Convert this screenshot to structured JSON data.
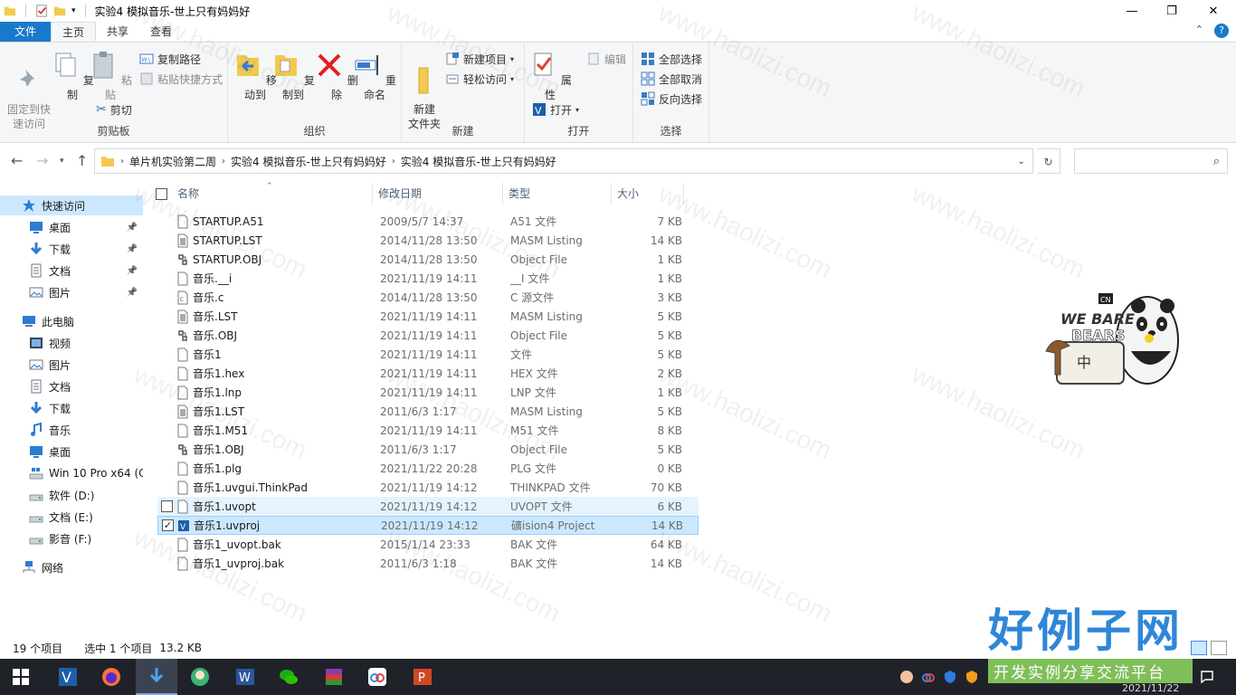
{
  "window": {
    "title": "实验4 模拟音乐-世上只有妈妈好",
    "minimize": "—",
    "maximize": "❐",
    "close": "✕"
  },
  "tabs": [
    "文件",
    "主页",
    "共享",
    "查看"
  ],
  "ribbon": {
    "clipboard": {
      "label": "剪贴板",
      "pin": "固定到快\n速访问",
      "copy": "复制",
      "paste": "粘贴",
      "copy_path": "复制路径",
      "paste_shortcut": "粘贴快捷方式",
      "cut": "剪切"
    },
    "organize": {
      "label": "组织",
      "move_to": "移动到",
      "copy_to": "复制到",
      "delete": "删除",
      "rename": "重命名"
    },
    "new": {
      "label": "新建",
      "new_folder": "新建\n文件夹",
      "new_item": "新建项目",
      "easy_access": "轻松访问"
    },
    "open": {
      "label": "打开",
      "properties": "属性",
      "open": "打开",
      "edit": "编辑"
    },
    "select": {
      "label": "选择",
      "select_all": "全部选择",
      "select_none": "全部取消",
      "invert": "反向选择"
    }
  },
  "address": {
    "crumbs": [
      "单片机实验第二周",
      "实验4 模拟音乐-世上只有妈妈好",
      "实验4 模拟音乐-世上只有妈妈好"
    ]
  },
  "nav": {
    "items": [
      {
        "label": "快速访问",
        "icon": "star-icon",
        "pinned": false,
        "indent": 0,
        "selected": true
      },
      {
        "label": "桌面",
        "icon": "desktop-icon",
        "pinned": true,
        "indent": 1
      },
      {
        "label": "下载",
        "icon": "download-icon",
        "pinned": true,
        "indent": 1
      },
      {
        "label": "文档",
        "icon": "document-icon",
        "pinned": true,
        "indent": 1
      },
      {
        "label": "图片",
        "icon": "picture-icon",
        "pinned": true,
        "indent": 1
      },
      {
        "label": "此电脑",
        "icon": "computer-icon",
        "pinned": false,
        "indent": 0
      },
      {
        "label": "视频",
        "icon": "video-icon",
        "pinned": false,
        "indent": 1
      },
      {
        "label": "图片",
        "icon": "picture-icon",
        "pinned": false,
        "indent": 1
      },
      {
        "label": "文档",
        "icon": "document-icon",
        "pinned": false,
        "indent": 1
      },
      {
        "label": "下载",
        "icon": "download-icon",
        "pinned": false,
        "indent": 1
      },
      {
        "label": "音乐",
        "icon": "music-icon",
        "pinned": false,
        "indent": 1
      },
      {
        "label": "桌面",
        "icon": "desktop-icon",
        "pinned": false,
        "indent": 1
      },
      {
        "label": "Win 10 Pro x64 (C",
        "icon": "windows-drive-icon",
        "pinned": false,
        "indent": 1
      },
      {
        "label": "软件 (D:)",
        "icon": "drive-icon",
        "pinned": false,
        "indent": 1
      },
      {
        "label": "文档 (E:)",
        "icon": "drive-icon",
        "pinned": false,
        "indent": 1
      },
      {
        "label": "影音 (F:)",
        "icon": "drive-icon",
        "pinned": false,
        "indent": 1
      },
      {
        "label": "网络",
        "icon": "network-icon",
        "pinned": false,
        "indent": 0
      }
    ]
  },
  "columns": {
    "name": "名称",
    "date": "修改日期",
    "type": "类型",
    "size": "大小"
  },
  "files": [
    {
      "name": "STARTUP.A51",
      "date": "2009/5/7 14:37",
      "type": "A51 文件",
      "size": "7 KB",
      "icon": "file"
    },
    {
      "name": "STARTUP.LST",
      "date": "2014/11/28 13:50",
      "type": "MASM Listing",
      "size": "14 KB",
      "icon": "text"
    },
    {
      "name": "STARTUP.OBJ",
      "date": "2014/11/28 13:50",
      "type": "Object File",
      "size": "1 KB",
      "icon": "obj"
    },
    {
      "name": "音乐.__i",
      "date": "2021/11/19 14:11",
      "type": "__I 文件",
      "size": "1 KB",
      "icon": "file"
    },
    {
      "name": "音乐.c",
      "date": "2014/11/28 13:50",
      "type": "C 源文件",
      "size": "3 KB",
      "icon": "c"
    },
    {
      "name": "音乐.LST",
      "date": "2021/11/19 14:11",
      "type": "MASM Listing",
      "size": "5 KB",
      "icon": "text"
    },
    {
      "name": "音乐.OBJ",
      "date": "2021/11/19 14:11",
      "type": "Object File",
      "size": "5 KB",
      "icon": "obj"
    },
    {
      "name": "音乐1",
      "date": "2021/11/19 14:11",
      "type": "文件",
      "size": "5 KB",
      "icon": "file"
    },
    {
      "name": "音乐1.hex",
      "date": "2021/11/19 14:11",
      "type": "HEX 文件",
      "size": "2 KB",
      "icon": "file"
    },
    {
      "name": "音乐1.lnp",
      "date": "2021/11/19 14:11",
      "type": "LNP 文件",
      "size": "1 KB",
      "icon": "file"
    },
    {
      "name": "音乐1.LST",
      "date": "2011/6/3 1:17",
      "type": "MASM Listing",
      "size": "5 KB",
      "icon": "text"
    },
    {
      "name": "音乐1.M51",
      "date": "2021/11/19 14:11",
      "type": "M51 文件",
      "size": "8 KB",
      "icon": "file"
    },
    {
      "name": "音乐1.OBJ",
      "date": "2011/6/3 1:17",
      "type": "Object File",
      "size": "5 KB",
      "icon": "obj"
    },
    {
      "name": "音乐1.plg",
      "date": "2021/11/22 20:28",
      "type": "PLG 文件",
      "size": "0 KB",
      "icon": "file"
    },
    {
      "name": "音乐1.uvgui.ThinkPad",
      "date": "2021/11/19 14:12",
      "type": "THINKPAD 文件",
      "size": "70 KB",
      "icon": "file"
    },
    {
      "name": "音乐1.uvopt",
      "date": "2021/11/19 14:12",
      "type": "UVOPT 文件",
      "size": "6 KB",
      "icon": "file",
      "state": "hover"
    },
    {
      "name": "音乐1.uvproj",
      "date": "2021/11/19 14:12",
      "type": "礦ision4 Project",
      "size": "14 KB",
      "icon": "uv",
      "state": "selected"
    },
    {
      "name": "音乐1_uvopt.bak",
      "date": "2015/1/14 23:33",
      "type": "BAK 文件",
      "size": "64 KB",
      "icon": "file"
    },
    {
      "name": "音乐1_uvproj.bak",
      "date": "2011/6/3 1:18",
      "type": "BAK 文件",
      "size": "14 KB",
      "icon": "file"
    }
  ],
  "status": {
    "count": "19 个项目",
    "selected": "选中 1 个项目",
    "size": "13.2 KB"
  },
  "sticker": {
    "top": "WE BARE",
    "bottom": "BEARS",
    "badge": "CN",
    "glyph": "中"
  },
  "brand": {
    "main": "好例子网",
    "sub": "开发实例分享交流平台",
    "date": "2021/11/22"
  },
  "watermark": "www.haolizi.com",
  "colors": {
    "accent": "#1979ca",
    "selection": "#cce8ff",
    "taskbar": "#1f2229"
  }
}
